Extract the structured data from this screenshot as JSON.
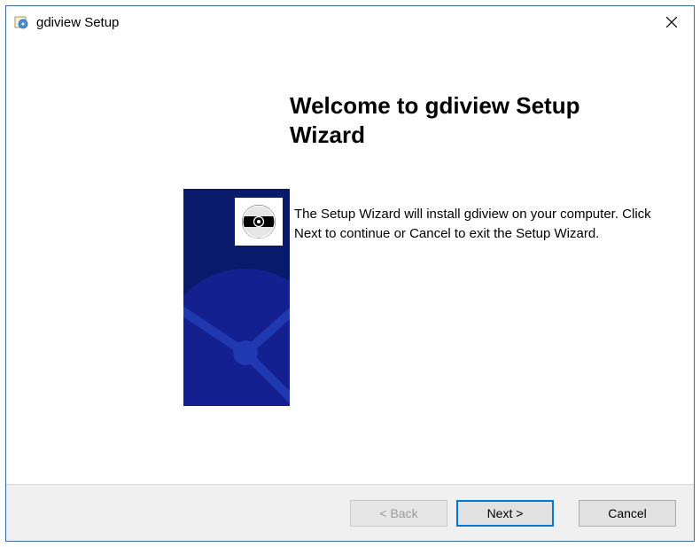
{
  "titlebar": {
    "title": "gdiview Setup"
  },
  "content": {
    "heading": "Welcome to gdiview Setup Wizard",
    "body": "The Setup Wizard will install gdiview on your computer.  Click Next to continue or Cancel to exit the Setup Wizard."
  },
  "footer": {
    "back_label": "< Back",
    "next_label": "Next >",
    "cancel_label": "Cancel"
  }
}
